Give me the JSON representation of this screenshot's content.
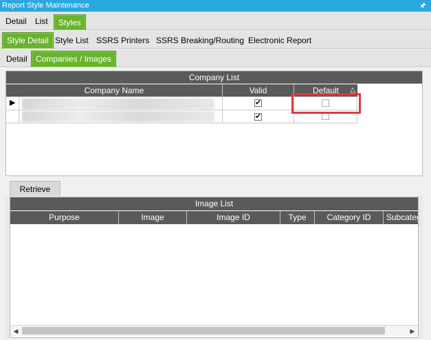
{
  "window": {
    "title": "Report Style Maintenance",
    "pin_icon": "pin-icon"
  },
  "tabs_level1": [
    "Detail",
    "List",
    "Styles"
  ],
  "tabs_level2": [
    "Style Detail",
    "Style List",
    "SSRS Printers",
    "SSRS Breaking/Routing",
    "Electronic Report"
  ],
  "tabs_level3": [
    "Detail",
    "Companies / Images"
  ],
  "company_list": {
    "title": "Company List",
    "columns": [
      "Company Name",
      "Valid",
      "Default"
    ],
    "rows": [
      {
        "company_name": "",
        "valid": true,
        "default": false
      },
      {
        "company_name": "",
        "valid": true,
        "default": false
      }
    ]
  },
  "retrieve_button": "Retrieve",
  "image_list": {
    "title": "Image List",
    "columns": [
      "Purpose",
      "Image",
      "Image ID",
      "Type",
      "Category ID",
      "Subcateg"
    ]
  },
  "colors": {
    "titlebar": "#29a8df",
    "active_tab": "#69b32d",
    "grid_header": "#5a5a5a",
    "highlight": "#e0393e"
  }
}
